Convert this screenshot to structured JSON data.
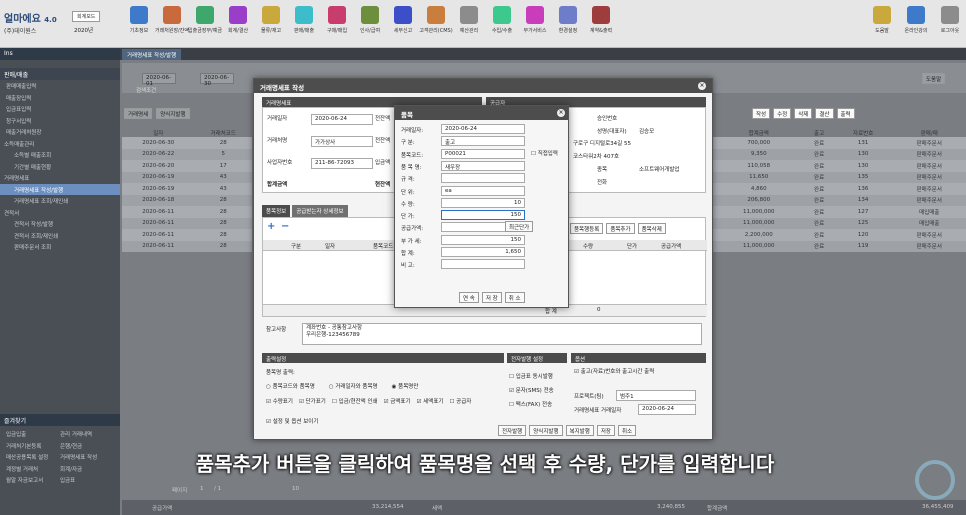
{
  "app": {
    "logo": "얼마에요",
    "version": "4.0",
    "company": "(주)데이원스",
    "year": "2020년",
    "mode_btn": "회계모드",
    "unit": "도구",
    "tool_label": "도움말"
  },
  "toolbar": [
    "기초정보",
    "거래처원장/잔액",
    "입출금장부/예금",
    "회계/결산",
    "물류/재고",
    "판매/매출",
    "구매/매입",
    "인사/급여",
    "세무신고",
    "고객관리(CMS)",
    "예산관리",
    "수입/수출",
    "부가서비스",
    "환경설정",
    "계약&출력"
  ],
  "toolbar_right": [
    "도움말",
    "온라인강의",
    "로그아웃"
  ],
  "sidebar": {
    "header": "Ins",
    "menu_title": "판매/매출",
    "items": [
      "판매매출입력",
      "매출장입력",
      "입금표입력",
      "청구서입력",
      "매출거래처원장",
      "소득매출관리",
      "소득별 매출조회",
      "기간별 매출현황",
      "거래명세표",
      "거래명세표 작성/발행",
      "거래명세표 조회/재인쇄",
      "견적서",
      "견적서 작성/발행",
      "견적서 조회/재인쇄",
      "판매주문서 조회"
    ],
    "selected": 9,
    "bottom_header": "즐겨찾기",
    "bottom_items": [
      [
        "입금입출",
        "관리 거래내역"
      ],
      [
        "거래처기본등록",
        "은행/현금"
      ],
      [
        "매산공용목록 설정",
        "거래명세표 작성"
      ],
      [
        "계정별 거래처",
        "회계/자금"
      ],
      [
        "월말 자금보고서",
        "입금표"
      ]
    ]
  },
  "main": {
    "tab": "거래명세표 작성/발행",
    "date_from": "2020-06-01",
    "date_to": "2020-06-30",
    "search_label": "검색조건",
    "tool_btn": "도움말",
    "buttons": [
      "거래명세",
      "양식지발행"
    ],
    "right_buttons": [
      "작성",
      "수정",
      "삭제",
      "결산",
      "출력"
    ],
    "right_cols": [
      "합계금액",
      "출고",
      "자료번호",
      "판매/매"
    ],
    "rows": [
      [
        "700,000",
        "완료",
        "131",
        "판매주문서"
      ],
      [
        "9,350",
        "완료",
        "130",
        "판매주문서"
      ],
      [
        "110,058",
        "완료",
        "130",
        "판매주문서"
      ],
      [
        "11,650",
        "완료",
        "135",
        "판매주문서"
      ],
      [
        "4,860",
        "완료",
        "136",
        "판매주문서"
      ],
      [
        "206,800",
        "완료",
        "134",
        "판매주문서"
      ],
      [
        "11,000,000",
        "완료",
        "127",
        "매입매출"
      ],
      [
        "11,000,000",
        "완료",
        "125",
        "매입매출"
      ],
      [
        "2,200,000",
        "완료",
        "120",
        "판매주문서"
      ],
      [
        "11,000,000",
        "완료",
        "119",
        "판매주문서"
      ]
    ],
    "left_cols": [
      "일자",
      "거래처코드"
    ],
    "left_rows": [
      [
        "2020-06-30",
        "28"
      ],
      [
        "2020-06-22",
        "5"
      ],
      [
        "2020-06-20",
        "17"
      ],
      [
        "2020-06-19",
        "43"
      ],
      [
        "2020-06-19",
        "43"
      ],
      [
        "2020-06-18",
        "28"
      ],
      [
        "2020-06-11",
        "28"
      ],
      [
        "2020-06-11",
        "28"
      ],
      [
        "2020-06-11",
        "28"
      ],
      [
        "2020-06-11",
        "28"
      ]
    ],
    "footer": {
      "page_label": "페이지",
      "page": "1",
      "total_pages": "/ 1",
      "page_size": "10",
      "total_label": "공급가액",
      "total1": "33,214,554",
      "tax_label": "세액",
      "tax": "3,240,855",
      "grand_label": "합계금액",
      "grand": "36,455,409"
    }
  },
  "dialog": {
    "title": "거래명세표 작성",
    "sec_doc": "거래명세표",
    "sec_supplier": "공급자",
    "date_label": "거래일자",
    "date": "2020-06-24",
    "prev_label": "전잔액",
    "partner_label": "거래처명",
    "partner": "가가상사",
    "bizno_label": "사업자번호",
    "bizno": "211-86-72093",
    "in_label": "입금액",
    "total_label": "합계금액",
    "cur_label": "현잔액",
    "sup_labels": [
      "승인번호",
      "성명(대표자)",
      "김승모"
    ],
    "sup_addr": "구로구 디지털로34길 55",
    "sup_addr2": "코스타워2차 407호",
    "sup_type": "종목",
    "sup_type_val": "소프트웨어개발업",
    "sup_tel": "전화",
    "tabs": [
      "품목정보",
      "공급받는자 상세정보"
    ],
    "grid_cols": [
      "구분",
      "일자",
      "품목코드",
      "수량",
      "단가",
      "공급가액"
    ],
    "grid_total": "합 계",
    "grid_total_val": "0",
    "item_btns": [
      "품목행등록",
      "품목추가",
      "품목삭제"
    ],
    "memo_label": "참고사항",
    "memo": "계좌번호 - 공통참고사항\n우리은행-123456789",
    "print_hd": "출력설정",
    "print_label": "품목명 출력:",
    "print_opts": [
      "품목코드와 품목명",
      "거래일자와 품목명",
      "품목명만"
    ],
    "print_checks": [
      "수량표기",
      "단가표기",
      "입금/현잔액 인쇄",
      "금액표기",
      "세액표기",
      "공급자"
    ],
    "show_opts": "설정 및 옵션 보이기",
    "efile_hd": "전자발행 설정",
    "efile_opts": [
      "입금표 동시발행",
      "문자(SMS) 전송",
      "팩스(FAX) 전송"
    ],
    "opt_hd": "옵션",
    "opt_check": "출고(자료)번호와 출고시간 출력",
    "project_label": "프로젝트(팀)",
    "project": "범주1",
    "trade_date_label": "거래명세표 거래일자",
    "trade_date": "2020-06-24",
    "bottom_btns": [
      "전자발행",
      "양식지발행",
      "복지발행",
      "저장",
      "취소"
    ]
  },
  "popup": {
    "title": "품목",
    "fields": [
      [
        "거래일자:",
        "2020-06-24"
      ],
      [
        "구    분:",
        "출고"
      ],
      [
        "품목코드:",
        "P00021"
      ],
      [
        "품 목 명:",
        "새우장"
      ],
      [
        "규    격:",
        ""
      ],
      [
        "단    위:",
        "ea"
      ],
      [
        "수    량:",
        "10"
      ],
      [
        "단    가:",
        "150"
      ],
      [
        "공급가액:",
        "1,500"
      ],
      [
        "부 가 세:",
        "150"
      ],
      [
        "합    계:",
        "1,650"
      ],
      [
        "비    고:",
        ""
      ]
    ],
    "direct_input": "직접입력",
    "recent_price": "최근단가",
    "btns": [
      "연 속",
      "저 장",
      "취 소"
    ]
  },
  "caption": "품목추가 버튼을 클릭하여 품목명을 선택 후 수량, 단가를 입력합니다"
}
